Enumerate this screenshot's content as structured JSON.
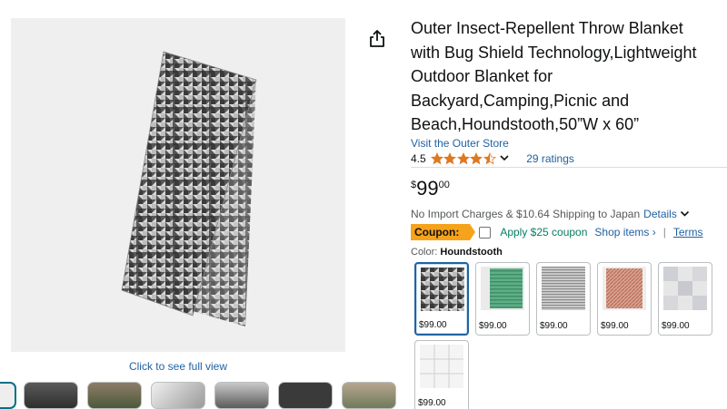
{
  "product": {
    "title_lines": [
      "Outer Insect-Repellent Throw Blanket",
      "with Bug Shield Technology,Lightweight",
      "Outdoor Blanket for",
      "Backyard,Camping,Picnic and",
      "Beach,Houndstooth,50”W x 60”"
    ],
    "store_link": "Visit the Outer Store",
    "rating": "4.5",
    "stars_value": 4.5,
    "ratings_count": "29 ratings",
    "price": {
      "symbol": "$",
      "whole": "99",
      "fraction": "00"
    },
    "shipping_text": "No Import Charges & $10.64 Shipping to Japan",
    "details_link": "Details",
    "coupon": {
      "badge": "Coupon:",
      "apply_text": "Apply $25 coupon",
      "shop_link": "Shop items ›",
      "separator": "|",
      "terms_link": "Terms"
    },
    "color_label": "Color:",
    "color_value": "Houndstooth",
    "swatches": [
      {
        "price": "$99.00",
        "pattern": "houndstooth",
        "selected": true
      },
      {
        "price": "$99.00",
        "pattern": "green-stripe",
        "selected": false
      },
      {
        "price": "$99.00",
        "pattern": "gray-stripe",
        "selected": false
      },
      {
        "price": "$99.00",
        "pattern": "rust-herringbone",
        "selected": false
      },
      {
        "price": "$99.00",
        "pattern": "gray-plaid",
        "selected": false
      },
      {
        "price": "$99.00",
        "pattern": "white-grid",
        "selected": false
      }
    ]
  },
  "gallery": {
    "full_view_label": "Click to see full view",
    "thumbnails": [
      "blanket-in-use",
      "outdoor-scene",
      "folded-blanket",
      "bed-scene",
      "dark-product-shot",
      "video-preview"
    ]
  },
  "icons": {
    "share": "share-icon",
    "star": "star-icon",
    "chevron": "chevron-down-icon"
  },
  "colors": {
    "link": "#2162a1",
    "star": "#de7921",
    "coupon": "#f6a31b",
    "coupon_apply": "#067d62",
    "selected_border": "#2162a1"
  }
}
